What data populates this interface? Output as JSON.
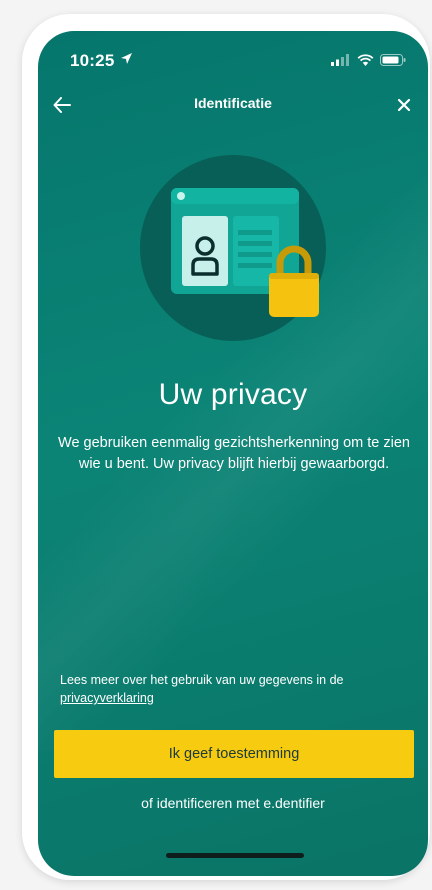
{
  "status_bar": {
    "time": "10:25",
    "location_icon": "location-arrow-icon",
    "signal_icon": "signal-icon",
    "wifi_icon": "wifi-icon",
    "battery_icon": "battery-icon"
  },
  "nav": {
    "title": "Identificatie",
    "back_icon": "arrow-left-icon",
    "close_icon": "close-icon"
  },
  "illustration": {
    "icons": [
      "id-card-icon",
      "padlock-icon"
    ]
  },
  "content": {
    "headline": "Uw privacy",
    "body": "We gebruiken eenmalig gezichtsherkenning om te zien wie u bent. Uw privacy blijft hierbij gewaarborgd.",
    "info_prefix": "Lees meer over het gebruik van uw gegevens in de ",
    "info_link": "privacyverklaring"
  },
  "actions": {
    "primary_label": "Ik geef toestemming",
    "secondary_label": "of identificeren met e.dentifier"
  },
  "colors": {
    "background": "#0a7d70",
    "primary_button": "#f7cb10",
    "primary_button_text": "#1c3a38",
    "text": "#ffffff"
  }
}
